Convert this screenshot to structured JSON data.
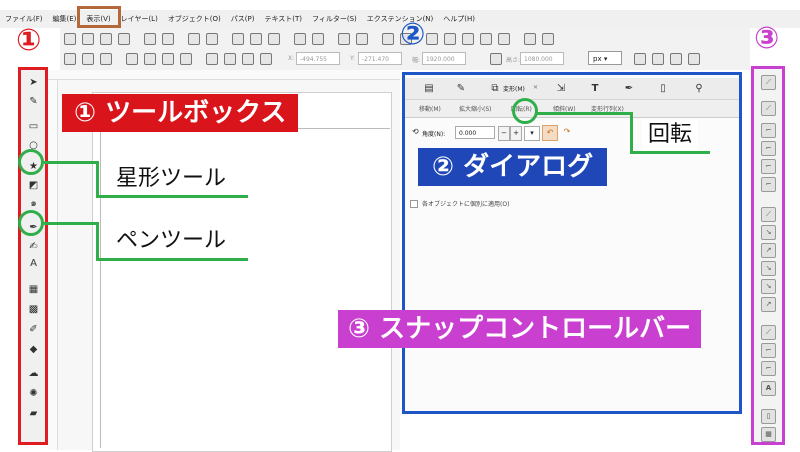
{
  "menu": {
    "items": [
      "ファイル(F)",
      "編集(E)",
      "表示(V)",
      "レイヤー(L)",
      "オブジェクト(O)",
      "パス(P)",
      "テキスト(T)",
      "フィルター(S)",
      "エクステンション(N)",
      "ヘルプ(H)"
    ]
  },
  "ctrlbar": {
    "x_label": "X:",
    "x_value": "-494.755",
    "y_label": "Y:",
    "y_value": "-271.470",
    "w_label": "幅:",
    "w_value": "1920.000",
    "h_label": "高さ:",
    "h_value": "1080.000",
    "unit": "px"
  },
  "toolbox": {
    "tools": [
      "selector",
      "node",
      "rect",
      "ellipse",
      "star",
      "3d-box",
      "spiral",
      "pen",
      "calligraphy",
      "text",
      "gradient",
      "mesh",
      "dropper",
      "paint-bucket",
      "tweak",
      "spray",
      "eraser"
    ]
  },
  "dialog": {
    "tabs": [
      "移動(M)",
      "拡大縮小(S)",
      "回転(R)",
      "傾斜(W)",
      "変形行列(X)"
    ],
    "panel_tab": "変形(M)",
    "panel_close": "✕",
    "angle_label": "角度(N):",
    "angle_value": "0.000",
    "apply_label": "各オブジェクトに個別に適用(O)"
  },
  "annotations": {
    "n1": "①",
    "n2": "②",
    "n3": "③",
    "toolbox_banner": "①  ツールボックス",
    "dialog_banner": "②  ダイアログ",
    "snapbar_banner": "③  スナップコントロールバー",
    "star_tool": "星形ツール",
    "pen_tool": "ペンツール",
    "rotate": "回転"
  },
  "colors": {
    "toolbox_frame": "#e11b22",
    "dialog_frame": "#1e56c7",
    "snapbar_frame": "#c93fcf",
    "callout_green": "#2fae4a",
    "menu_highlight": "#b4683a"
  }
}
